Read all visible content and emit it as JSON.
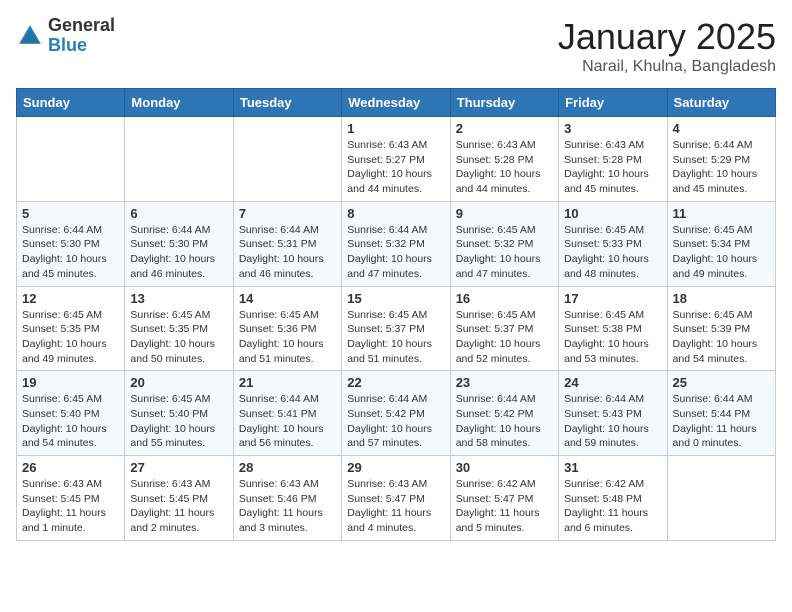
{
  "header": {
    "logo_general": "General",
    "logo_blue": "Blue",
    "month_title": "January 2025",
    "subtitle": "Narail, Khulna, Bangladesh"
  },
  "calendar": {
    "headers": [
      "Sunday",
      "Monday",
      "Tuesday",
      "Wednesday",
      "Thursday",
      "Friday",
      "Saturday"
    ],
    "weeks": [
      [
        {
          "day": "",
          "info": ""
        },
        {
          "day": "",
          "info": ""
        },
        {
          "day": "",
          "info": ""
        },
        {
          "day": "1",
          "info": "Sunrise: 6:43 AM\nSunset: 5:27 PM\nDaylight: 10 hours\nand 44 minutes."
        },
        {
          "day": "2",
          "info": "Sunrise: 6:43 AM\nSunset: 5:28 PM\nDaylight: 10 hours\nand 44 minutes."
        },
        {
          "day": "3",
          "info": "Sunrise: 6:43 AM\nSunset: 5:28 PM\nDaylight: 10 hours\nand 45 minutes."
        },
        {
          "day": "4",
          "info": "Sunrise: 6:44 AM\nSunset: 5:29 PM\nDaylight: 10 hours\nand 45 minutes."
        }
      ],
      [
        {
          "day": "5",
          "info": "Sunrise: 6:44 AM\nSunset: 5:30 PM\nDaylight: 10 hours\nand 45 minutes."
        },
        {
          "day": "6",
          "info": "Sunrise: 6:44 AM\nSunset: 5:30 PM\nDaylight: 10 hours\nand 46 minutes."
        },
        {
          "day": "7",
          "info": "Sunrise: 6:44 AM\nSunset: 5:31 PM\nDaylight: 10 hours\nand 46 minutes."
        },
        {
          "day": "8",
          "info": "Sunrise: 6:44 AM\nSunset: 5:32 PM\nDaylight: 10 hours\nand 47 minutes."
        },
        {
          "day": "9",
          "info": "Sunrise: 6:45 AM\nSunset: 5:32 PM\nDaylight: 10 hours\nand 47 minutes."
        },
        {
          "day": "10",
          "info": "Sunrise: 6:45 AM\nSunset: 5:33 PM\nDaylight: 10 hours\nand 48 minutes."
        },
        {
          "day": "11",
          "info": "Sunrise: 6:45 AM\nSunset: 5:34 PM\nDaylight: 10 hours\nand 49 minutes."
        }
      ],
      [
        {
          "day": "12",
          "info": "Sunrise: 6:45 AM\nSunset: 5:35 PM\nDaylight: 10 hours\nand 49 minutes."
        },
        {
          "day": "13",
          "info": "Sunrise: 6:45 AM\nSunset: 5:35 PM\nDaylight: 10 hours\nand 50 minutes."
        },
        {
          "day": "14",
          "info": "Sunrise: 6:45 AM\nSunset: 5:36 PM\nDaylight: 10 hours\nand 51 minutes."
        },
        {
          "day": "15",
          "info": "Sunrise: 6:45 AM\nSunset: 5:37 PM\nDaylight: 10 hours\nand 51 minutes."
        },
        {
          "day": "16",
          "info": "Sunrise: 6:45 AM\nSunset: 5:37 PM\nDaylight: 10 hours\nand 52 minutes."
        },
        {
          "day": "17",
          "info": "Sunrise: 6:45 AM\nSunset: 5:38 PM\nDaylight: 10 hours\nand 53 minutes."
        },
        {
          "day": "18",
          "info": "Sunrise: 6:45 AM\nSunset: 5:39 PM\nDaylight: 10 hours\nand 54 minutes."
        }
      ],
      [
        {
          "day": "19",
          "info": "Sunrise: 6:45 AM\nSunset: 5:40 PM\nDaylight: 10 hours\nand 54 minutes."
        },
        {
          "day": "20",
          "info": "Sunrise: 6:45 AM\nSunset: 5:40 PM\nDaylight: 10 hours\nand 55 minutes."
        },
        {
          "day": "21",
          "info": "Sunrise: 6:44 AM\nSunset: 5:41 PM\nDaylight: 10 hours\nand 56 minutes."
        },
        {
          "day": "22",
          "info": "Sunrise: 6:44 AM\nSunset: 5:42 PM\nDaylight: 10 hours\nand 57 minutes."
        },
        {
          "day": "23",
          "info": "Sunrise: 6:44 AM\nSunset: 5:42 PM\nDaylight: 10 hours\nand 58 minutes."
        },
        {
          "day": "24",
          "info": "Sunrise: 6:44 AM\nSunset: 5:43 PM\nDaylight: 10 hours\nand 59 minutes."
        },
        {
          "day": "25",
          "info": "Sunrise: 6:44 AM\nSunset: 5:44 PM\nDaylight: 11 hours\nand 0 minutes."
        }
      ],
      [
        {
          "day": "26",
          "info": "Sunrise: 6:43 AM\nSunset: 5:45 PM\nDaylight: 11 hours\nand 1 minute."
        },
        {
          "day": "27",
          "info": "Sunrise: 6:43 AM\nSunset: 5:45 PM\nDaylight: 11 hours\nand 2 minutes."
        },
        {
          "day": "28",
          "info": "Sunrise: 6:43 AM\nSunset: 5:46 PM\nDaylight: 11 hours\nand 3 minutes."
        },
        {
          "day": "29",
          "info": "Sunrise: 6:43 AM\nSunset: 5:47 PM\nDaylight: 11 hours\nand 4 minutes."
        },
        {
          "day": "30",
          "info": "Sunrise: 6:42 AM\nSunset: 5:47 PM\nDaylight: 11 hours\nand 5 minutes."
        },
        {
          "day": "31",
          "info": "Sunrise: 6:42 AM\nSunset: 5:48 PM\nDaylight: 11 hours\nand 6 minutes."
        },
        {
          "day": "",
          "info": ""
        }
      ]
    ]
  }
}
